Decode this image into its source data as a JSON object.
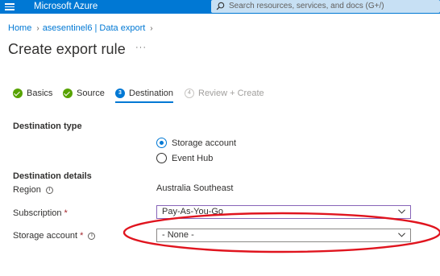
{
  "topbar": {
    "brand": "Microsoft Azure",
    "search_placeholder": "Search resources, services, and docs (G+/)"
  },
  "breadcrumb": {
    "home": "Home",
    "workspace": "asesentinel6 | Data export"
  },
  "page": {
    "title": "Create export rule",
    "more": "···"
  },
  "steps": [
    {
      "label": "Basics",
      "state": "complete"
    },
    {
      "label": "Source",
      "state": "complete"
    },
    {
      "label": "Destination",
      "number": "3",
      "state": "current"
    },
    {
      "label": "Review + Create",
      "number": "4",
      "state": "disabled"
    }
  ],
  "destination_type": {
    "heading": "Destination type",
    "options": [
      {
        "label": "Storage account",
        "selected": true
      },
      {
        "label": "Event Hub",
        "selected": false
      }
    ]
  },
  "destination_details": {
    "heading": "Destination details",
    "region_label": "Region",
    "region_value": "Australia Southeast",
    "subscription_label": "Subscription",
    "subscription_value": "Pay-As-You-Go",
    "storage_label": "Storage account",
    "storage_value": "- None -",
    "required_marker": "*"
  },
  "colors": {
    "azure_blue": "#0078d4",
    "complete_green": "#57a300",
    "annotation_red": "#e0141e",
    "focus_purple": "#8764b8"
  }
}
